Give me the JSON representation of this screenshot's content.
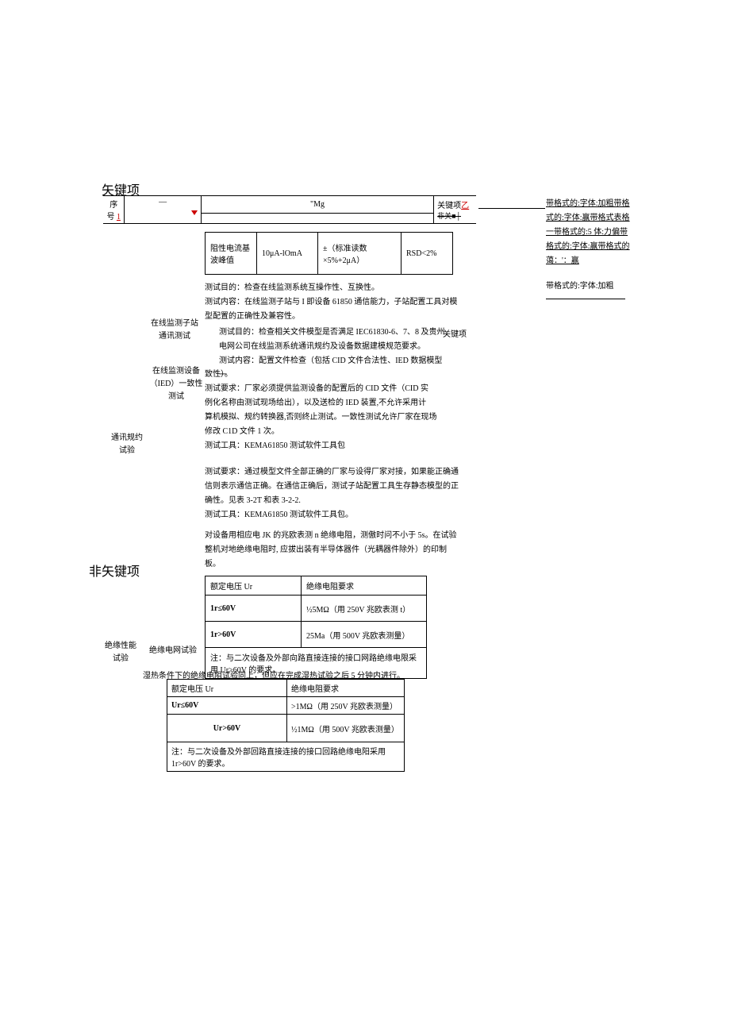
{
  "titles": {
    "key": "矢键项",
    "nonkey": "非矢键项"
  },
  "header_row": {
    "seq_label": "序",
    "seq_num_label": "号",
    "one": "1",
    "dash": "—",
    "mg": "\"Mg",
    "key_label": "关键项",
    "yi": "乙",
    "strike_text": "非关■│"
  },
  "sub_table": {
    "r1c1": "阻性电流基波峰值",
    "r1c2": "10μA-lOmA",
    "r1c3": "±（标准读数×5%+2μA）",
    "r1c4": "RSD<2%"
  },
  "para1_lines": [
    "测试目的：检查在线监测系统互操作性、互换性。",
    "测试内容：在线监测子站与 I 即设备 61850 通信能力，子站配置工具对模",
    "型配置的正确性及兼容性。"
  ],
  "para2_lines": [
    "测试目的：检查相关文件模型是否满足 IEC61830-6、7、8 及贵州",
    "电网公司在线监测系统通讯规约及设备数据建模规范要求。",
    "测试内容：配置文件检查（包括 CID 文件合法性、IED 数据模型一",
    "致性）。",
    "测试要求：厂家必须提供监测设备的配置后的 CID 文件（CID 实",
    "例化名称由测试现场给出），以及送检的 IED 装置,不允许采用计",
    "算机模拟、规约转换器,否则终止测试。一致性测试允许厂家在现场",
    "修改 C1D 文件 1 次。",
    "测试工具：KEMA61850 测试软件工具包"
  ],
  "para3_lines": [
    "测试要求：通过模型文件全部正确的厂家与设得厂家对接，如果能正确通",
    "信则表示通信正确。在通信正确后，测试子站配置工具生存静态模型的正",
    "确性。见表 3-2T 和表 3-2-2.",
    "测试工具：KEMA61850 测试软件工具包。"
  ],
  "para4_lines": [
    "对设备用相应电 JK 的兆欧表测 n 绝缘电阻，测傲时问不小于 5s。在试验",
    "整机对地绝缘电阻时, 应拔出装有半导体器件（光耦器件除外）的印制",
    "板。"
  ],
  "labels": {
    "sub_station": "在线监测子站通讯测试",
    "ied": "在线监测设备（IED）一致性测试",
    "comm": "通讯规约试验",
    "insul_perf": "绝缘性能试验",
    "insul_net": "绝缘电网试验"
  },
  "key_side": "关键项",
  "insul_table1": {
    "h1": "额定电压 Ur",
    "h2": "绝缘电阻要求",
    "r1c1": "1r≤60V",
    "r1c2": "½5MΩ（用 250V 兆欧表测 t）",
    "r2c1": "1r>60V",
    "r2c2": "25Ma（用 500V 兆欧表测量）",
    "note": "注：与二次设备及外部向路直接连接的接口网路绝缘电限采用 Ur>60V 的要求。"
  },
  "damp_note": "湿热条件下的绝缘电阻试验同上，但应在完成湿热试验之后 5 分钟内进行。",
  "insul_table2": {
    "h1": "额定电压 Ur",
    "h2": "绝缘电阻要求",
    "r1c1": "Ur≤60V",
    "r1c2": ">1MΩ（用 250V 兆欧表测量）",
    "r2c1": "Ur>60V",
    "r2c2": "½1MΩ（用 500V 兆欧表测量）",
    "note": "注：与二次设备及外部回路直接连接的接口回路绝缘电阳采用 1r>60V 的要求。"
  },
  "right_notes": {
    "l1": "带格式的:字体:加粗带格",
    "l2": "式的:字体:赢带格式表格",
    "l3": "一带格式的:5 体:力偏带",
    "l4": "格式的:字体:赢带格式的",
    "l5": "蔼：'：赢",
    "l6": "带格式的:字体:加粗"
  }
}
